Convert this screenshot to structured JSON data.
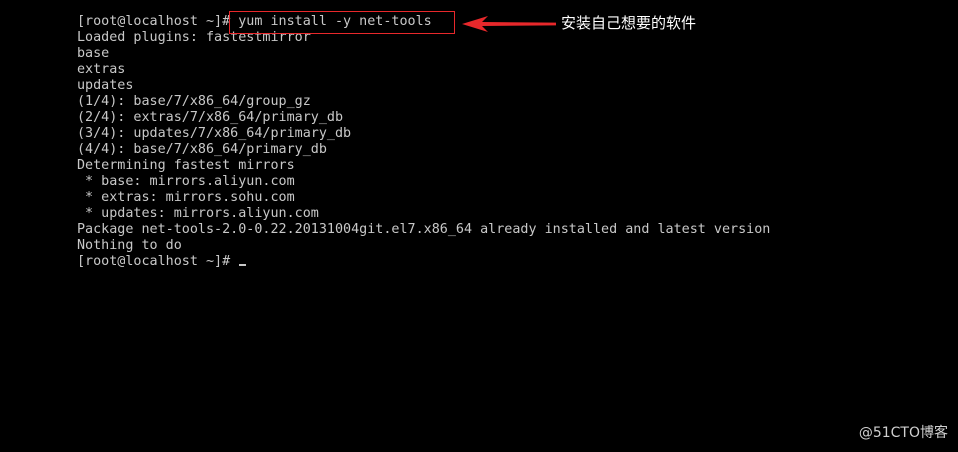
{
  "terminal": {
    "lines": [
      "[root@localhost ~]# yum install -y net-tools",
      "Loaded plugins: fastestmirror",
      "base",
      "extras",
      "updates",
      "(1/4): base/7/x86_64/group_gz",
      "(2/4): extras/7/x86_64/primary_db",
      "(3/4): updates/7/x86_64/primary_db",
      "(4/4): base/7/x86_64/primary_db",
      "Determining fastest mirrors",
      " * base: mirrors.aliyun.com",
      " * extras: mirrors.sohu.com",
      " * updates: mirrors.aliyun.com",
      "Package net-tools-2.0-0.22.20131004git.el7.x86_64 already installed and latest version",
      "Nothing to do",
      "[root@localhost ~]# "
    ],
    "text_color": "#c8c8c8",
    "background": "#000000"
  },
  "annotation": {
    "text": "安装自己想要的软件",
    "color": "#ffffff",
    "highlight_color": "#e8282b"
  },
  "watermark": {
    "text": "@51CTO博客"
  }
}
